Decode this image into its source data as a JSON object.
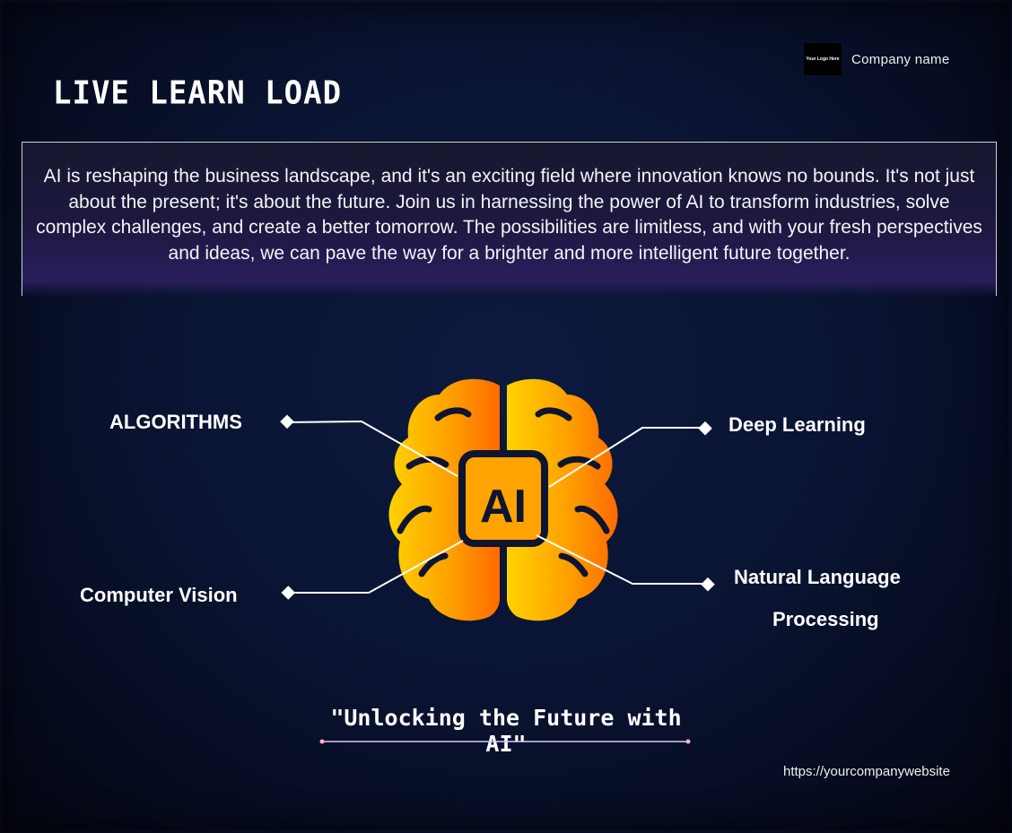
{
  "header": {
    "title": "LIVE LEARN LOAD",
    "logo_text": "Your Logo Here",
    "company_name": "Company name"
  },
  "intro": {
    "text": "AI is reshaping the business landscape, and it's an exciting field where innovation knows no bounds. It's not just about the present; it's about the future. Join us in harnessing the power of AI to transform industries, solve complex challenges, and create a better tomorrow. The possibilities are limitless, and with your fresh perspectives and ideas, we can pave the way for a brighter and more intelligent future together."
  },
  "diagram": {
    "center_label": "AI",
    "branches": {
      "top_left": "ALGORITHMS",
      "top_right": "Deep Learning",
      "bottom_left": "Computer Vision",
      "bottom_right_line1": "Natural Language",
      "bottom_right_line2": "Processing"
    }
  },
  "footer": {
    "tagline": "\"Unlocking the Future with AI\"",
    "website": "https://yourcompanywebsite"
  },
  "colors": {
    "background": "#0a1433",
    "brain_gradient_start": "#ffd200",
    "brain_gradient_end": "#ff6a00",
    "line": "#ffffff"
  }
}
